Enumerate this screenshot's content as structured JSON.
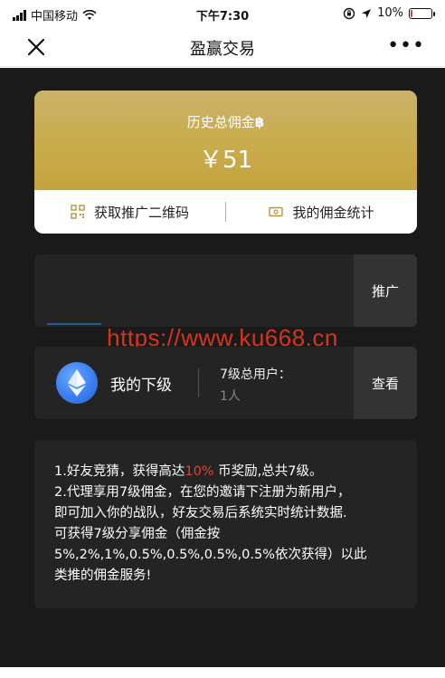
{
  "status_bar": {
    "carrier": "中国移动",
    "time": "下午7:30",
    "battery_percent": "10%",
    "battery_level": 0.1
  },
  "nav": {
    "title": "盈赢交易"
  },
  "commission_card": {
    "label": "历史总佣金",
    "currency_symbol": "฿",
    "amount": "￥51",
    "qr_action": "获取推广二维码",
    "stats_action": "我的佣金统计"
  },
  "promote": {
    "button_label": "推广"
  },
  "watermark": "https://www.ku668.cn",
  "subordinates": {
    "title": "我的下级",
    "stat_label": "7级总用户：",
    "stat_value": "1人",
    "button_label": "查看"
  },
  "info": {
    "line1_prefix": "1.好友竞猜，获得高达",
    "line1_highlight": "10%",
    "line1_suffix": " 币奖励,总共7级。",
    "line2": "2.代理享用7级佣金，在您的邀请下注册为新用户，",
    "line3": "即可加入你的战队，好友交易后系统实时统计数据.",
    "line4": "可获得7级分享佣金（佣金按",
    "line5": "5%,2%,1%,0.5%,0.5%,0.5%,0.5%依次获得）以此",
    "line6": "类推的佣金服务!"
  },
  "colors": {
    "gold": "#c9ac4c",
    "highlight_red": "#e8412c",
    "background_dark": "#1a1a1a",
    "panel": "#242424"
  }
}
